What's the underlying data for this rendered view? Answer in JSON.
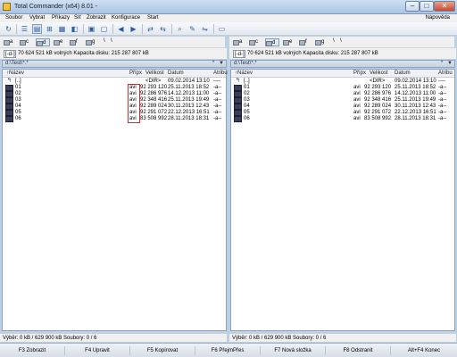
{
  "window": {
    "title": "Total Commander (x64) 8.01 -"
  },
  "menu": {
    "items": [
      "Soubor",
      "Vybrat",
      "Příkazy",
      "Síť",
      "Zobrazit",
      "Konfigurace",
      "Start"
    ],
    "help": "Nápověda"
  },
  "toolbar": {
    "icons": [
      "refresh-icon",
      "view-brief-icon",
      "view-full-icon",
      "view-tree-icon",
      "view-thumbs-icon",
      "invert-icon",
      "archive-pack-icon",
      "archive-unpack-icon",
      "back-icon",
      "forward-icon",
      "ftp-connect-icon",
      "ftp-disconnect-icon",
      "search-icon",
      "rename-icon",
      "sync-icon",
      "notepad-icon"
    ]
  },
  "drives": {
    "left": {
      "items": [
        "a",
        "c",
        "d",
        "e",
        "f",
        "g"
      ],
      "extra": [
        "\\",
        "\\"
      ],
      "active": "d"
    },
    "right": {
      "items": [
        "a",
        "c",
        "d",
        "e",
        "f",
        "g"
      ],
      "extra": [
        "\\",
        "\\"
      ],
      "active": "d"
    }
  },
  "left_panel": {
    "drive_select": "[-d-]",
    "free_text": "70 624 521 kB volných   Kapacita disku: 215 287 807 kB",
    "path": "d:\\Test\\*.*",
    "path_star": "*",
    "path_arrow": "▼",
    "columns": {
      "name": "↑Název",
      "ext": "Přípx",
      "size": "Velikost",
      "date": "Datum",
      "attr": "Atribu"
    },
    "rows": [
      {
        "name": "[..]",
        "ext": "",
        "size": "<DIR>",
        "date": "09.02.2014 13:10",
        "attr": "----"
      },
      {
        "name": "01",
        "ext": "avi",
        "size": "92 293 120",
        "date": "25.11.2013 18:52",
        "attr": "-a--"
      },
      {
        "name": "02",
        "ext": "avi",
        "size": "92 286 976",
        "date": "14.12.2013 11:00",
        "attr": "-a--"
      },
      {
        "name": "03",
        "ext": "avi",
        "size": "92 348 416",
        "date": "25.11.2013 19:49",
        "attr": "-a--"
      },
      {
        "name": "04",
        "ext": "avi",
        "size": "92 289 024",
        "date": "30.11.2013 12:43",
        "attr": "-a--"
      },
      {
        "name": "05",
        "ext": "avi",
        "size": "92 291 072",
        "date": "22.12.2013 16:51",
        "attr": "-a--"
      },
      {
        "name": "06",
        "ext": "avi",
        "size": "83 508 992",
        "date": "28.11.2013 18:31",
        "attr": "-a--"
      }
    ],
    "status": "Výběr: 0 kB / 629 900 kB  Soubory: 0 / 6"
  },
  "right_panel": {
    "drive_select": "[-d-]",
    "free_text": "70 624 521 kB volných   Kapacita disku: 215 287 807 kB",
    "path": "d:\\Test\\*.*",
    "path_star": "*",
    "path_arrow": "▼",
    "columns": {
      "name": "↑Název",
      "ext": "Přípx",
      "size": "Velikost",
      "date": "Datum",
      "attr": "Atribu"
    },
    "rows": [
      {
        "name": "[..]",
        "ext": "",
        "size": "<DIR>",
        "date": "09.02.2014 13:10",
        "attr": "----"
      },
      {
        "name": "01",
        "ext": "avi",
        "size": "92 293 120",
        "date": "25.11.2013 18:52",
        "attr": "-a--"
      },
      {
        "name": "02",
        "ext": "avi",
        "size": "92 286 976",
        "date": "14.12.2013 11:00",
        "attr": "-a--"
      },
      {
        "name": "03",
        "ext": "avi",
        "size": "92 348 416",
        "date": "25.11.2013 19:49",
        "attr": "-a--"
      },
      {
        "name": "04",
        "ext": "avi",
        "size": "92 289 024",
        "date": "30.11.2013 12:43",
        "attr": "-a--"
      },
      {
        "name": "05",
        "ext": "avi",
        "size": "92 291 072",
        "date": "22.12.2013 16:51",
        "attr": "-a--"
      },
      {
        "name": "06",
        "ext": "avi",
        "size": "83 508 992",
        "date": "28.11.2013 18:31",
        "attr": "-a--"
      }
    ],
    "status": "Výběr: 0 kB / 629 900 kB  Soubory: 0 / 6"
  },
  "fkeys": [
    "F3 Zobrazit",
    "F4 Upravit",
    "F5 Kopírovat",
    "F6 PřejmPřes",
    "F7 Nová složka",
    "F8 Odstranit",
    "Alt+F4 Konec"
  ],
  "colors": {
    "highlight": "#d12a2a",
    "title_bar": "#a9c4e4"
  }
}
